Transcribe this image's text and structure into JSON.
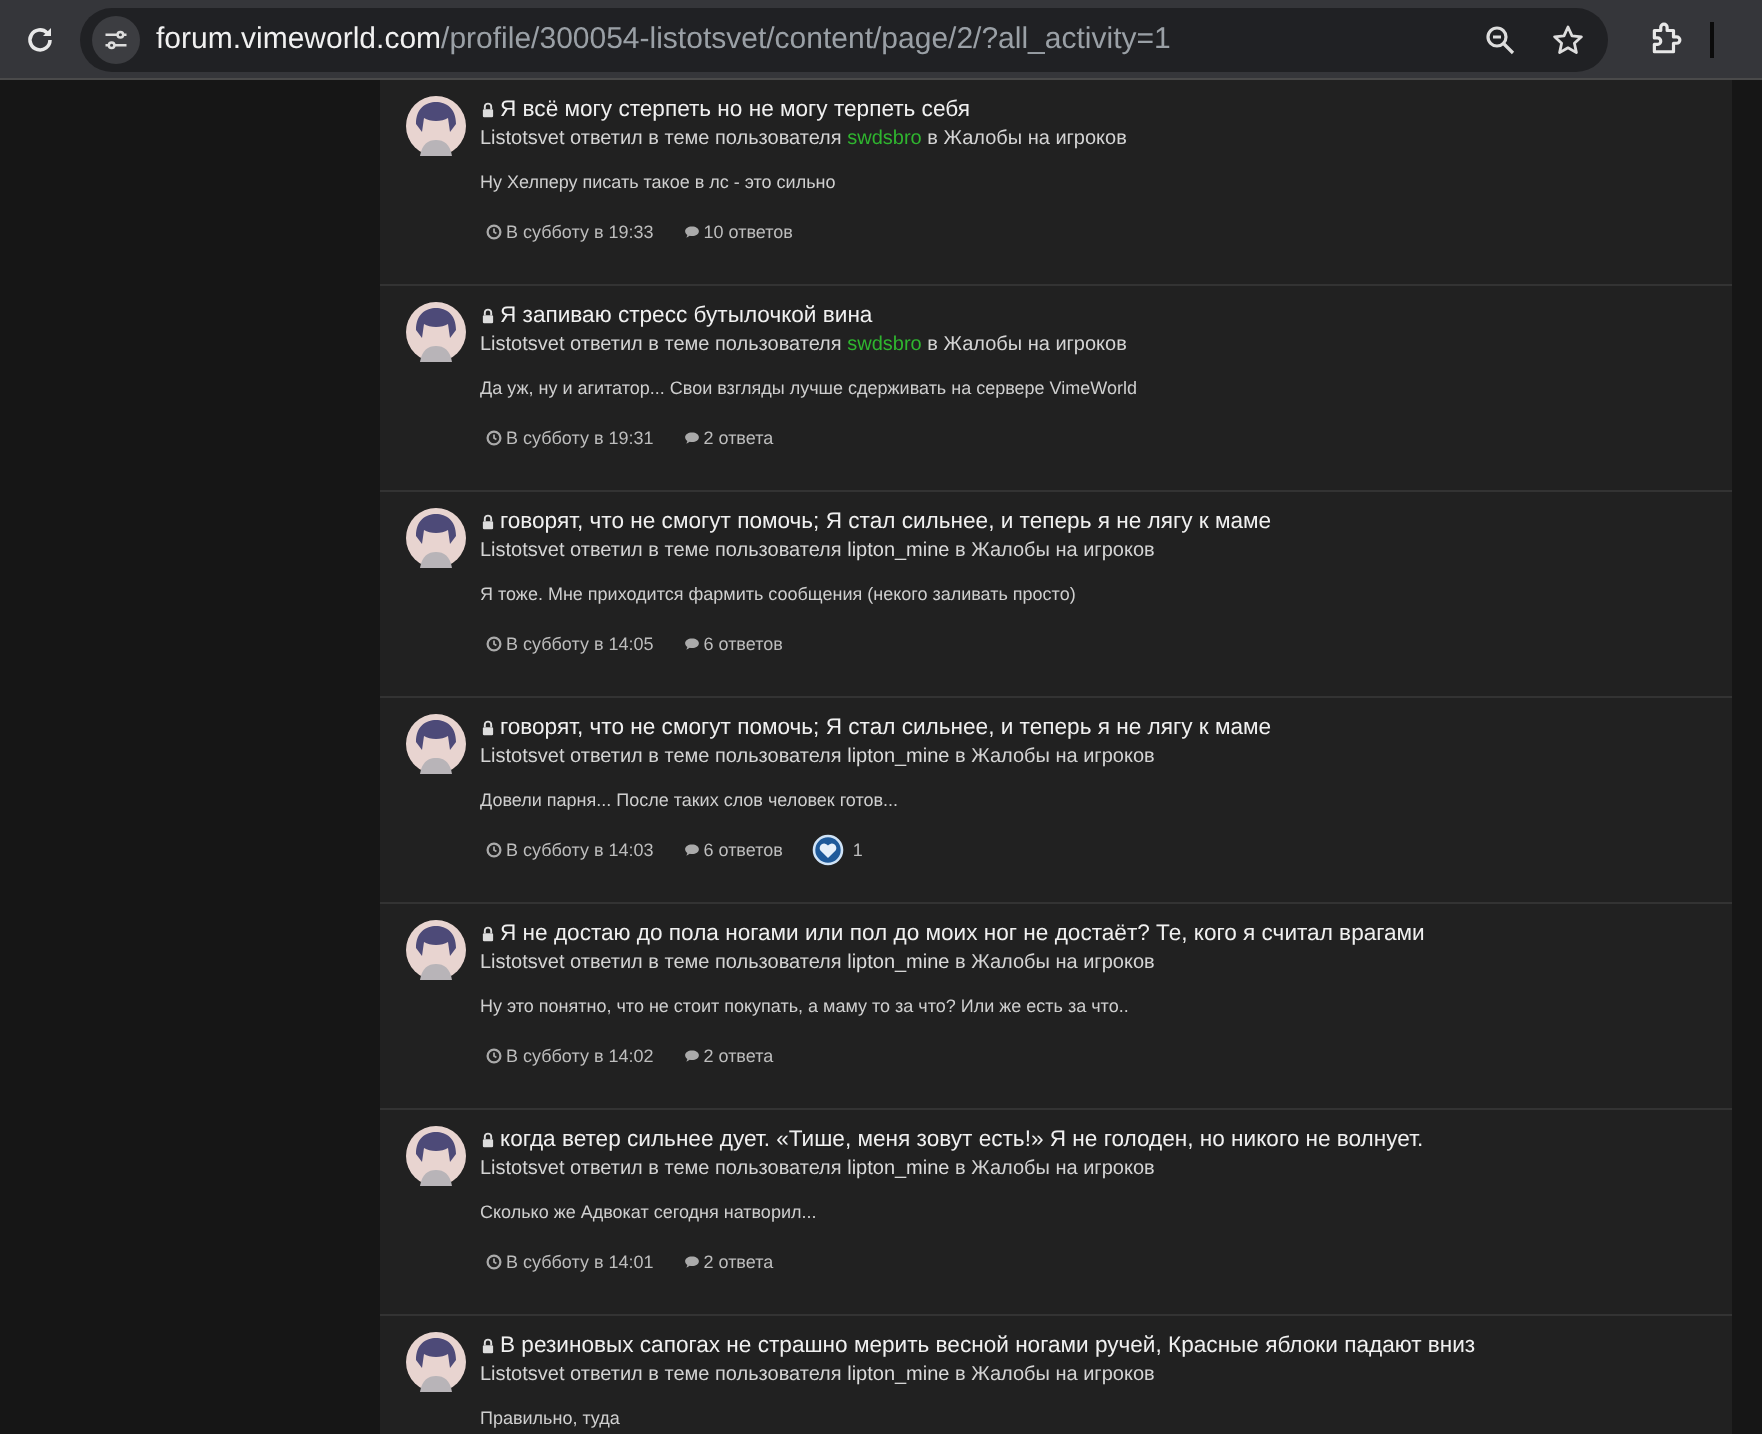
{
  "browser": {
    "url_host": "forum.vimeworld.com",
    "url_path": "/profile/300054-listotsvet/content/page/2/?all_activity=1"
  },
  "activity": [
    {
      "locked": true,
      "title": "Я всё могу стерпеть но не могу терпеть себя",
      "author": "Listotsvet",
      "action": "ответил в теме пользователя",
      "user": {
        "name": "swdsbro",
        "color": "#2fb52f"
      },
      "in": "в",
      "forum": "Жалобы на игроков",
      "excerpt": "Ну Хелперу писать такое в лс - это сильно",
      "time": "В субботу в 19:33",
      "replies": "10 ответов"
    },
    {
      "locked": true,
      "title": "Я запиваю стресс бутылочкой вина",
      "author": "Listotsvet",
      "action": "ответил в теме пользователя",
      "user": {
        "name": "swdsbro",
        "color": "#2fb52f"
      },
      "in": "в",
      "forum": "Жалобы на игроков",
      "excerpt": "Да уж, ну и агитатор... Свои взгляды лучше сдерживать на сервере VimeWorld",
      "time": "В субботу в 19:31",
      "replies": "2 ответа"
    },
    {
      "locked": true,
      "title": "говорят, что не смогут помочь; Я стал сильнее, и теперь я не лягу к маме",
      "author": "Listotsvet",
      "action": "ответил в теме пользователя",
      "user": {
        "name": "lipton_mine",
        "color": "#dcdcdc"
      },
      "in": "в",
      "forum": "Жалобы на игроков",
      "excerpt": "Я тоже. Мне приходится фармить сообщения (некого заливать просто)",
      "time": "В субботу в 14:05",
      "replies": "6 ответов"
    },
    {
      "locked": true,
      "title": "говорят, что не смогут помочь; Я стал сильнее, и теперь я не лягу к маме",
      "author": "Listotsvet",
      "action": "ответил в теме пользователя",
      "user": {
        "name": "lipton_mine",
        "color": "#dcdcdc"
      },
      "in": "в",
      "forum": "Жалобы на игроков",
      "excerpt": "Довели парня... После таких слов человек готов...",
      "time": "В субботу в 14:03",
      "replies": "6 ответов",
      "reactions": "1"
    },
    {
      "locked": true,
      "title": "Я не достаю до пола ногами или пол до моих ног не достаёт? Те, кого я считал врагами",
      "author": "Listotsvet",
      "action": "ответил в теме пользователя",
      "user": {
        "name": "lipton_mine",
        "color": "#dcdcdc"
      },
      "in": "в",
      "forum": "Жалобы на игроков",
      "excerpt": "Ну это понятно, что не стоит покупать, а маму то за что? Или же есть за что..",
      "time": "В субботу в 14:02",
      "replies": "2 ответа"
    },
    {
      "locked": true,
      "title": "когда ветер сильнее дует. «Тише, меня зовут есть!» Я не голоден, но никого не волнует.",
      "author": "Listotsvet",
      "action": "ответил в теме пользователя",
      "user": {
        "name": "lipton_mine",
        "color": "#dcdcdc"
      },
      "in": "в",
      "forum": "Жалобы на игроков",
      "excerpt": "Сколько же Адвокат сегодня натворил...",
      "time": "В субботу в 14:01",
      "replies": "2 ответа"
    },
    {
      "locked": true,
      "title": "В резиновых сапогах не страшно мерить весной ногами ручей, Красные яблоки падают вниз",
      "author": "Listotsvet",
      "action": "ответил в теме пользователя",
      "user": {
        "name": "lipton_mine",
        "color": "#dcdcdc"
      },
      "in": "в",
      "forum": "Жалобы на игроков",
      "excerpt": "Правильно, туда"
    }
  ]
}
